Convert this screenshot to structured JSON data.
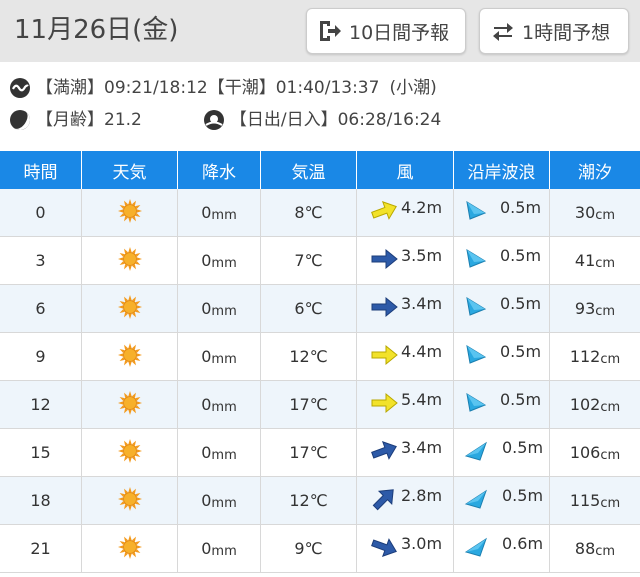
{
  "header": {
    "date": "11月26日(金)",
    "btn_10day": "10日間予報",
    "btn_1hour": "1時間予想"
  },
  "tide_info": {
    "high_label": "【満潮】",
    "high_value": "09:21/18:12",
    "low_label": "【干潮】",
    "low_value": "01:40/13:37",
    "tide_type": "(小潮)",
    "moon_label": "【月齢】",
    "moon_value": "21.2",
    "sun_label": "【日出/日入】",
    "sun_value": "06:28/16:24"
  },
  "columns": [
    "時間",
    "天気",
    "降水",
    "気温",
    "風",
    "沿岸波浪",
    "潮汐"
  ],
  "colors": {
    "header_bg": "#1a88e6",
    "row_alt": "#eef5fb",
    "sun": "#f39a1c",
    "wind_weak": "#f2e22a",
    "wind_strong": "#2d5aa8",
    "wave": "#2aa8e0"
  },
  "rows": [
    {
      "time": "0",
      "weather": "sun-icon",
      "precip": "0",
      "precip_unit": "mm",
      "temp": "8℃",
      "wind": "4.2m",
      "wind_color": "yellow",
      "wind_dir": -20,
      "wave": "0.5m",
      "wave_dir": "tri-up",
      "tide": "30",
      "tide_unit": "cm"
    },
    {
      "time": "3",
      "weather": "sun-icon",
      "precip": "0",
      "precip_unit": "mm",
      "temp": "7℃",
      "wind": "3.5m",
      "wind_color": "blue",
      "wind_dir": 0,
      "wave": "0.5m",
      "wave_dir": "tri-up",
      "tide": "41",
      "tide_unit": "cm"
    },
    {
      "time": "6",
      "weather": "sun-icon",
      "precip": "0",
      "precip_unit": "mm",
      "temp": "6℃",
      "wind": "3.4m",
      "wind_color": "blue",
      "wind_dir": 0,
      "wave": "0.5m",
      "wave_dir": "tri-up",
      "tide": "93",
      "tide_unit": "cm"
    },
    {
      "time": "9",
      "weather": "sun-icon",
      "precip": "0",
      "precip_unit": "mm",
      "temp": "12℃",
      "wind": "4.4m",
      "wind_color": "yellow",
      "wind_dir": 0,
      "wave": "0.5m",
      "wave_dir": "tri-up",
      "tide": "112",
      "tide_unit": "cm"
    },
    {
      "time": "12",
      "weather": "sun-icon",
      "precip": "0",
      "precip_unit": "mm",
      "temp": "17℃",
      "wind": "5.4m",
      "wind_color": "yellow",
      "wind_dir": 0,
      "wave": "0.5m",
      "wave_dir": "tri-up",
      "tide": "102",
      "tide_unit": "cm"
    },
    {
      "time": "15",
      "weather": "sun-icon",
      "precip": "0",
      "precip_unit": "mm",
      "temp": "17℃",
      "wind": "3.4m",
      "wind_color": "blue",
      "wind_dir": -20,
      "wave": "0.5m",
      "wave_dir": "tri-left",
      "tide": "106",
      "tide_unit": "cm"
    },
    {
      "time": "18",
      "weather": "sun-icon",
      "precip": "0",
      "precip_unit": "mm",
      "temp": "12℃",
      "wind": "2.8m",
      "wind_color": "blue",
      "wind_dir": -45,
      "wave": "0.5m",
      "wave_dir": "tri-left",
      "tide": "115",
      "tide_unit": "cm"
    },
    {
      "time": "21",
      "weather": "sun-icon",
      "precip": "0",
      "precip_unit": "mm",
      "temp": "9℃",
      "wind": "3.0m",
      "wind_color": "blue",
      "wind_dir": 20,
      "wave": "0.6m",
      "wave_dir": "tri-left",
      "tide": "88",
      "tide_unit": "cm"
    }
  ]
}
